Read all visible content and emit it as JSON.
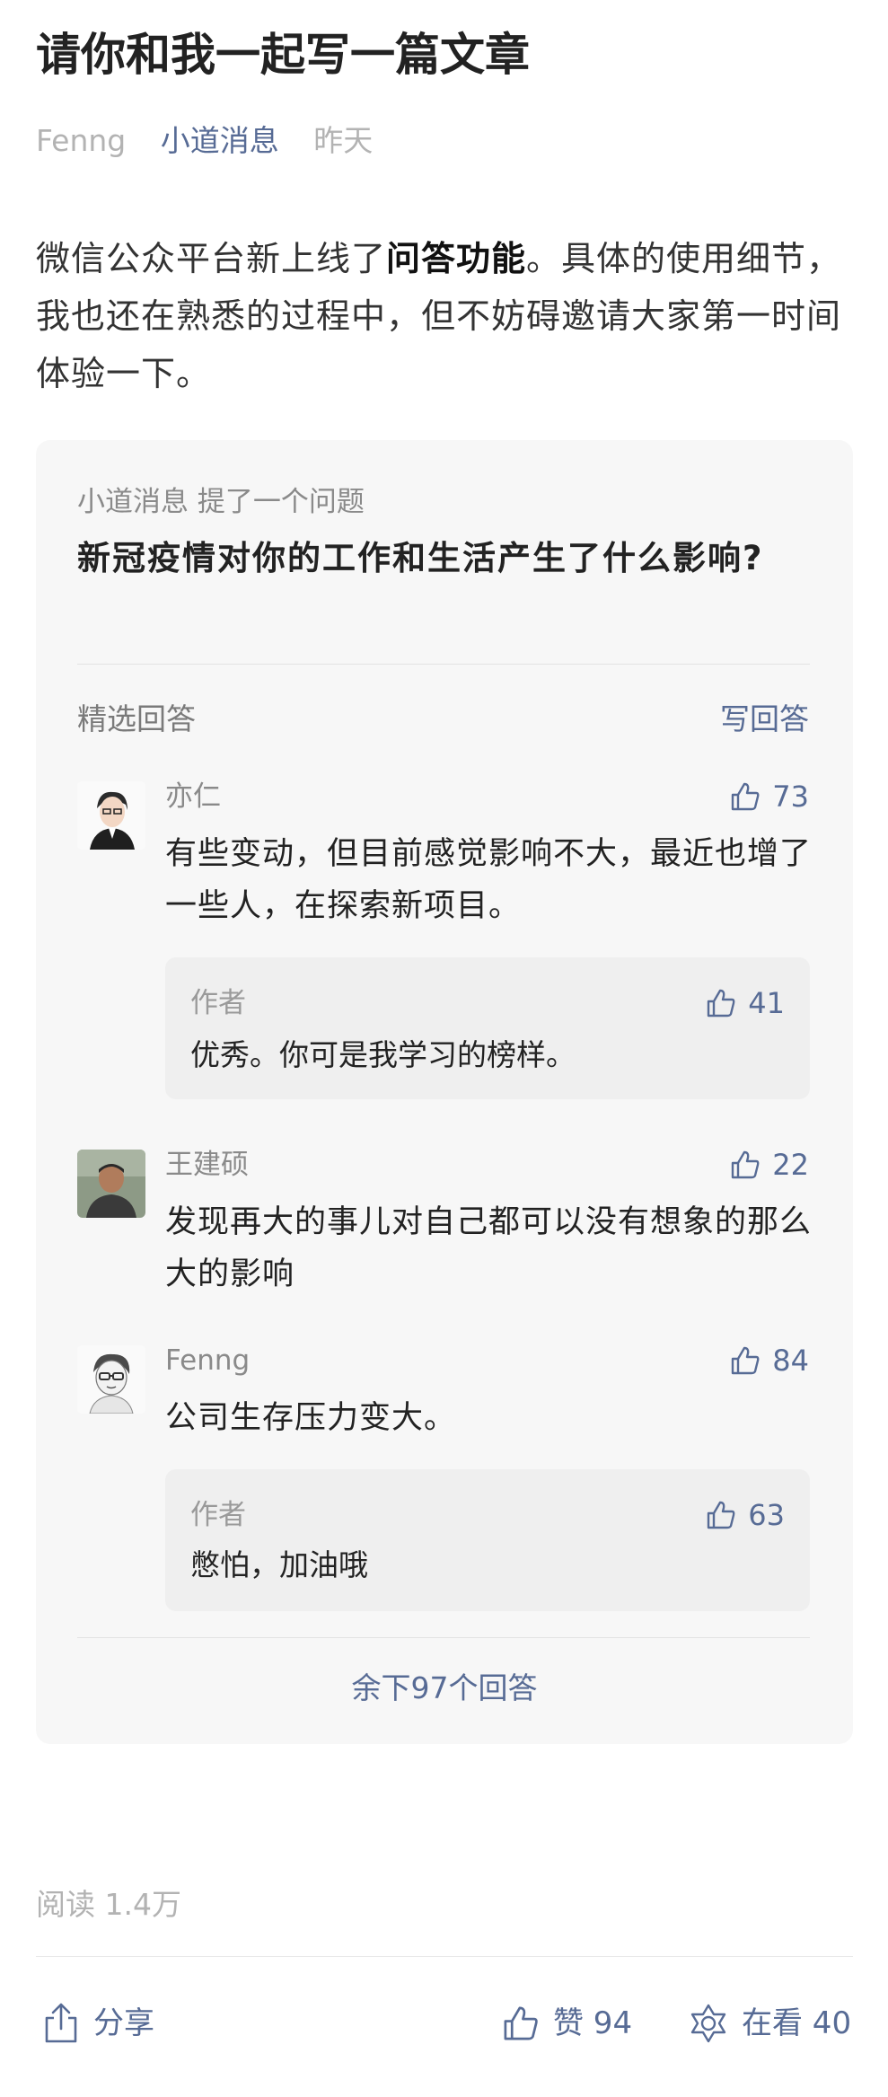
{
  "article": {
    "title": "请你和我一起写一篇文章",
    "author": "Fenng",
    "account": "小道消息",
    "date": "昨天",
    "intro_part1": "微信公众平台新上线了",
    "intro_bold": "问答功能",
    "intro_part2": "。具体的使用细节，我也还在熟悉的过程中，但不妨碍邀请大家第一时间体验一下。"
  },
  "qa": {
    "asker": "小道消息 提了一个问题",
    "question": "新冠疫情对你的工作和生活产生了什么影响?",
    "selected_label": "精选回答",
    "write_label": "写回答",
    "answers": [
      {
        "name": "亦仁",
        "likes": "73",
        "text": "有些变动，但目前感觉影响不大，最近也增了一些人，在探索新项目。",
        "reply": {
          "name": "作者",
          "likes": "41",
          "text": "优秀。你可是我学习的榜样。"
        }
      },
      {
        "name": "王建硕",
        "likes": "22",
        "text": "发现再大的事儿对自己都可以没有想象的那么大的影响"
      },
      {
        "name": "Fenng",
        "likes": "84",
        "text": "公司生存压力变大。",
        "reply": {
          "name": "作者",
          "likes": "63",
          "text": "憋怕，加油哦"
        }
      }
    ],
    "more": "余下97个回答"
  },
  "footer": {
    "reads": "阅读 1.4万",
    "share": "分享",
    "like": "赞 94",
    "wow": "在看 40"
  },
  "colors": {
    "link": "#576b95",
    "muted": "#b3b3b3",
    "card_bg": "#f7f7f7",
    "reply_bg": "#efefef"
  }
}
